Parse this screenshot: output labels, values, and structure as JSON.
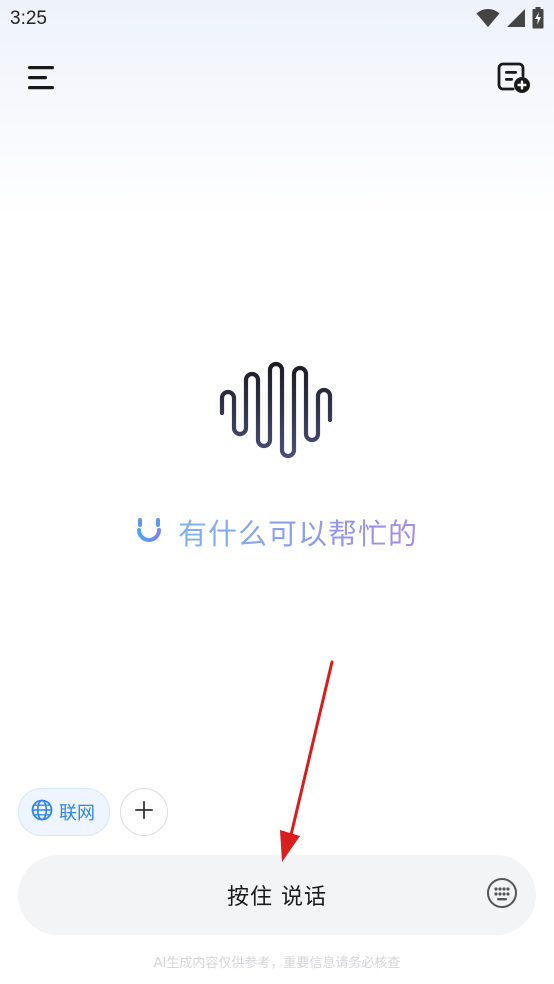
{
  "status_bar": {
    "time": "3:25",
    "icons": [
      "wifi-icon",
      "signal-icon",
      "battery-charging-icon"
    ]
  },
  "header": {
    "menu_icon": "menu-icon",
    "new_chat_icon": "new-chat-icon"
  },
  "main": {
    "logo_icon": "sound-wave-logo-icon",
    "greeting_icon": "smile-icon",
    "greeting": "有什么可以帮忙的"
  },
  "chips": {
    "web_search_label": "联网",
    "web_search_icon": "globe-icon",
    "add_icon": "plus-icon"
  },
  "input_bar": {
    "voice_label": "按住 说话",
    "keyboard_icon": "keyboard-icon"
  },
  "footer": {
    "disclaimer": "AI生成内容仅供参考，重要信息请务必核查"
  },
  "colors": {
    "accent_blue": "#2f86e6",
    "greeting_gradient_start": "#7fb4ec",
    "greeting_gradient_end": "#a78bea",
    "annotation_red": "#d81e1e"
  }
}
